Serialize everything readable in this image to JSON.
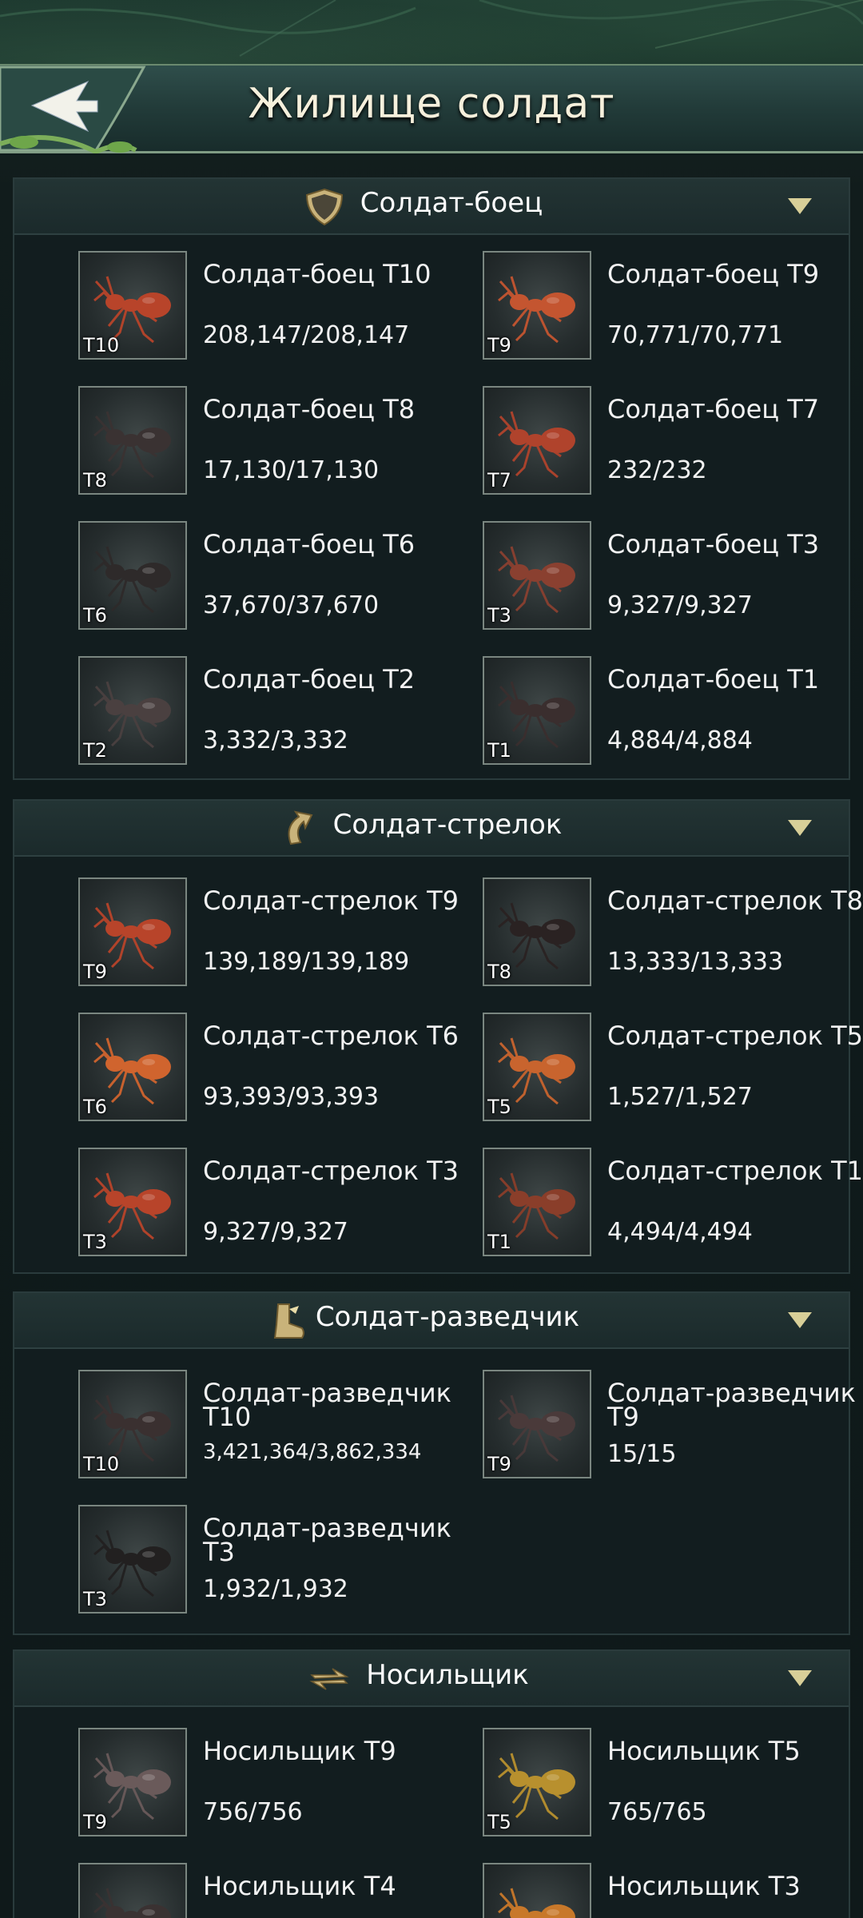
{
  "header": {
    "title": "Жилище солдат"
  },
  "sections": [
    {
      "title": "Солдат-боец",
      "icon": "shield-icon",
      "units": [
        {
          "name": "Солдат-боец T10",
          "count": "208,147/208,147",
          "tier": "T10"
        },
        {
          "name": "Солдат-боец T9",
          "count": "70,771/70,771",
          "tier": "T9"
        },
        {
          "name": "Солдат-боец T8",
          "count": "17,130/17,130",
          "tier": "T8"
        },
        {
          "name": "Солдат-боец T7",
          "count": "232/232",
          "tier": "T7"
        },
        {
          "name": "Солдат-боец T6",
          "count": "37,670/37,670",
          "tier": "T6"
        },
        {
          "name": "Солдат-боец T3",
          "count": "9,327/9,327",
          "tier": "T3"
        },
        {
          "name": "Солдат-боец T2",
          "count": "3,332/3,332",
          "tier": "T2"
        },
        {
          "name": "Солдат-боец T1",
          "count": "4,884/4,884",
          "tier": "T1"
        }
      ]
    },
    {
      "title": "Солдат-стрелок",
      "icon": "shooter-icon",
      "units": [
        {
          "name": "Солдат-стрелок T9",
          "count": "139,189/139,189",
          "tier": "T9"
        },
        {
          "name": "Солдат-стрелок T8",
          "count": "13,333/13,333",
          "tier": "T8"
        },
        {
          "name": "Солдат-стрелок T6",
          "count": "93,393/93,393",
          "tier": "T6"
        },
        {
          "name": "Солдат-стрелок T5",
          "count": "1,527/1,527",
          "tier": "T5"
        },
        {
          "name": "Солдат-стрелок T3",
          "count": "9,327/9,327",
          "tier": "T3"
        },
        {
          "name": "Солдат-стрелок T1",
          "count": "4,494/4,494",
          "tier": "T1"
        }
      ]
    },
    {
      "title": "Солдат-разведчик",
      "icon": "scout-boot-icon",
      "units": [
        {
          "name": "Солдат-разведчик T10",
          "count": "3,421,364/3,862,334",
          "tier": "T10"
        },
        {
          "name": "Солдат-разведчик T9",
          "count": "15/15",
          "tier": "T9"
        },
        {
          "name": "Солдат-разведчик T3",
          "count": "1,932/1,932",
          "tier": "T3"
        }
      ]
    },
    {
      "title": "Носильщик",
      "icon": "carrier-arrows-icon",
      "units": [
        {
          "name": "Носильщик T9",
          "count": "756/756",
          "tier": "T9"
        },
        {
          "name": "Носильщик T5",
          "count": "765/765",
          "tier": "T5"
        },
        {
          "name": "Носильщик T4",
          "count": "",
          "tier": ""
        },
        {
          "name": "Носильщик T3",
          "count": "",
          "tier": ""
        }
      ]
    }
  ],
  "colors": {
    "ant_red": "#b8442a",
    "ant_orange": "#d0642e",
    "ant_dark": "#3a3232",
    "ant_black": "#1c1a1a",
    "ant_yellow": "#b8902e",
    "accent_gold": "#d8c690"
  }
}
